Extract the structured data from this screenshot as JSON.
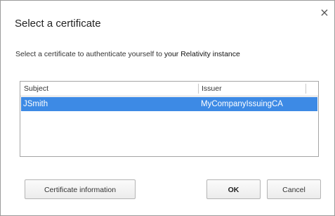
{
  "dialog": {
    "title": "Select a certificate",
    "prompt_prefix": "Select a certificate to authenticate yourself to ",
    "prompt_target": "your Relativity instance",
    "close_glyph": "×"
  },
  "table": {
    "columns": [
      "Subject",
      "Issuer"
    ],
    "rows": [
      {
        "subject": "JSmith",
        "issuer": "MyCompanyIssuingCA",
        "selected": true
      }
    ]
  },
  "buttons": {
    "info_label": "Certificate information",
    "ok_label": "OK",
    "cancel_label": "Cancel"
  },
  "colors": {
    "selection": "#3d8ae5"
  }
}
